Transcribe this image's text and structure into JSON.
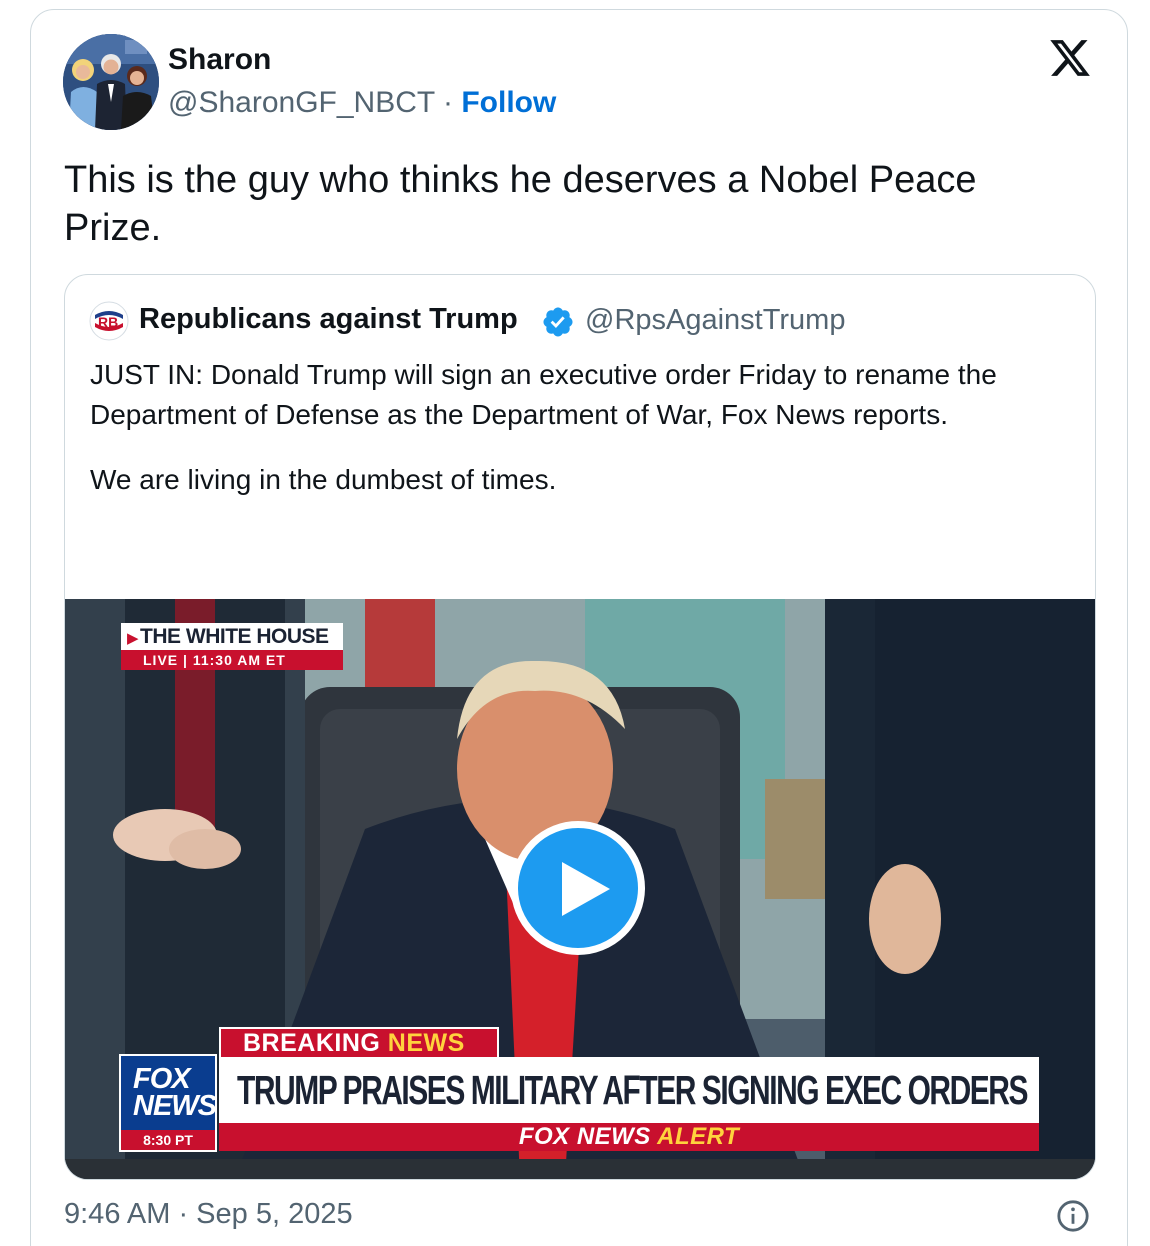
{
  "tweet": {
    "author": {
      "name": "Sharon",
      "handle": "@SharonGF_NBCT",
      "separator": "·",
      "follow_label": "Follow"
    },
    "text": "This is the guy who thinks he deserves a Nobel Peace Prize.",
    "timestamp": "9:46 AM · Sep 5, 2025",
    "icons": {
      "brand": "x-logo-icon",
      "info": "info-icon",
      "verified": "verified-badge-icon",
      "play": "play-icon"
    },
    "colors": {
      "follow": "#006fd6",
      "verified": "#1d9bf0",
      "play": "#1d9bf0",
      "muted": "#536471"
    }
  },
  "quoted": {
    "author": {
      "avatar_text": "RB",
      "name": "Republicans against Trump",
      "handle": "@RpsAgainstTrump"
    },
    "text_1": "JUST IN: Donald Trump will sign an executive order Friday to rename the Department of Defense as the Department of War, Fox News reports.",
    "text_2": "We are living in the dumbest of times.",
    "video": {
      "live_title": "THE WHITE HOUSE",
      "live_label": "LIVE",
      "live_time": "11:30 AM ET",
      "breaking_1": "BREAKING",
      "breaking_2": "NEWS",
      "headline": "TRUMP PRAISES MILITARY AFTER SIGNING EXEC ORDERS",
      "logo_line_1": "FOX",
      "logo_line_2": "NEWS",
      "logo_time": "8:30 PT",
      "alert_1": "FOX NEWS",
      "alert_2": "ALERT"
    }
  }
}
